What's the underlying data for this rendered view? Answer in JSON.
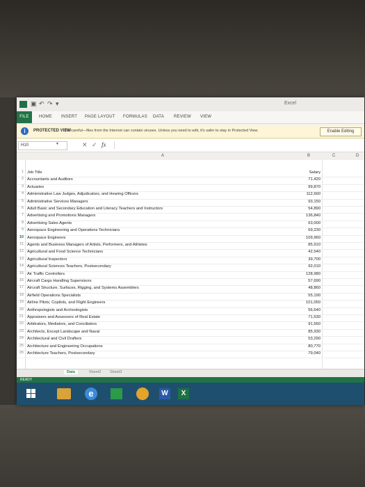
{
  "window": {
    "title": "Excel",
    "qat": [
      "↶",
      "↷",
      "▾"
    ]
  },
  "ribbon": {
    "tabs": [
      "FILE",
      "HOME",
      "INSERT",
      "PAGE LAYOUT",
      "FORMULAS",
      "DATA",
      "REVIEW",
      "VIEW"
    ]
  },
  "protected_view": {
    "title": "PROTECTED VIEW",
    "message": "Be careful—files from the Internet can contain viruses. Unless you need to edit, it's safer to stay in Protected View.",
    "button": "Enable Editing"
  },
  "formula_bar": {
    "name_box": "H10",
    "fx": "fx"
  },
  "columns": [
    "A",
    "B",
    "C",
    "D"
  ],
  "table": {
    "rows": [
      {
        "num": "1",
        "a": "Job Title",
        "b": "Salary"
      },
      {
        "num": "2",
        "a": "Accountants and Auditors",
        "b": "71,420"
      },
      {
        "num": "3",
        "a": "Actuaries",
        "b": "99,870"
      },
      {
        "num": "4",
        "a": "Administrative Law Judges, Adjudicators, and Hearing Officers",
        "b": "112,660"
      },
      {
        "num": "5",
        "a": "Administrative Services Managers",
        "b": "93,150"
      },
      {
        "num": "6",
        "a": "Adult Basic and Secondary Education and Literacy Teachers and Instructors",
        "b": "54,890"
      },
      {
        "num": "7",
        "a": "Advertising and Promotions Managers",
        "b": "136,840"
      },
      {
        "num": "8",
        "a": "Advertising Sales Agents",
        "b": "63,000"
      },
      {
        "num": "9",
        "a": "Aerospace Engineering and Operations Technicians",
        "b": "69,230"
      },
      {
        "num": "10",
        "a": "Aerospace Engineers",
        "b": "109,960"
      },
      {
        "num": "11",
        "a": "Agents and Business Managers of Artists, Performers, and Athletes",
        "b": "85,910"
      },
      {
        "num": "12",
        "a": "Agricultural and Food Science Technicians",
        "b": "42,540"
      },
      {
        "num": "13",
        "a": "Agricultural Inspectors",
        "b": "39,700"
      },
      {
        "num": "14",
        "a": "Agricultural Sciences Teachers, Postsecondary",
        "b": "92,010"
      },
      {
        "num": "15",
        "a": "Air Traffic Controllers",
        "b": "128,980"
      },
      {
        "num": "16",
        "a": "Aircraft Cargo Handling Supervisors",
        "b": "57,690"
      },
      {
        "num": "17",
        "a": "Aircraft Structure, Surfaces, Rigging, and Systems Assemblers",
        "b": "48,860"
      },
      {
        "num": "18",
        "a": "Airfield Operations Specialists",
        "b": "55,190"
      },
      {
        "num": "19",
        "a": "Airline Pilots, Copilots, and Flight Engineers",
        "b": "101,050"
      },
      {
        "num": "20",
        "a": "Anthropologists and Archeologists",
        "b": "56,640"
      },
      {
        "num": "21",
        "a": "Appraisers and Assessors of Real Estate",
        "b": "71,530"
      },
      {
        "num": "22",
        "a": "Arbitrators, Mediators, and Conciliators",
        "b": "91,560"
      },
      {
        "num": "23",
        "a": "Architects, Except Landscape and Naval",
        "b": "85,930"
      },
      {
        "num": "24",
        "a": "Architectural and Civil Drafters",
        "b": "53,290"
      },
      {
        "num": "25",
        "a": "Architecture and Engineering Occupations",
        "b": "80,770"
      },
      {
        "num": "26",
        "a": "Architecture Teachers, Postsecondary",
        "b": "79,040"
      }
    ]
  },
  "sheets": [
    "Data",
    "Sheet2",
    "Sheet3"
  ],
  "status": "READY",
  "colors": {
    "excel_green": "#217346",
    "taskbar": "#1f4f6e",
    "protected_bg": "#fdf5d6",
    "info_blue": "#2b6dc2"
  }
}
